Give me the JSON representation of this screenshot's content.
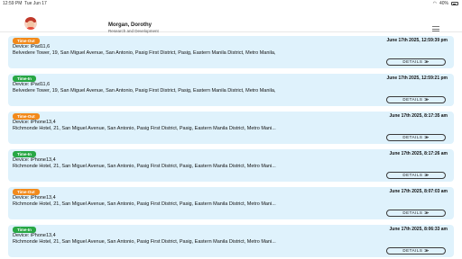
{
  "status_bar": {
    "time": "12:59 PM",
    "date": "Tue Jun 17",
    "battery": "40%"
  },
  "header": {
    "user_name": "Morgan, Dorothy",
    "department": "Research and Development"
  },
  "records": [
    {
      "badge": "Time-Out",
      "type": "out",
      "timestamp": "June 17th 2025, 12:59:39 pm",
      "device": "Device: iPad11,6",
      "address": "Belvedere Tower, 19, San Miguel Avenue, San Antonio, Pasig First District, Pasig, Eastern Manila District, Metro Manila,",
      "button": "DETAILS"
    },
    {
      "badge": "Time-In",
      "type": "in",
      "timestamp": "June 17th 2025, 12:59:21 pm",
      "device": "Device: iPad11,6",
      "address": "Belvedere Tower, 19, San Miguel Avenue, San Antonio, Pasig First District, Pasig, Eastern Manila District, Metro Manila,",
      "button": "DETAILS"
    },
    {
      "badge": "Time-Out",
      "type": "out",
      "timestamp": "June 17th 2025, 8:17:35 am",
      "device": "Device: iPhone13,4",
      "address": "Richmonde Hotel, 21, San Miguel Avenue, San Antonio, Pasig First District, Pasig, Eastern Manila District, Metro Mani...",
      "button": "DETAILS"
    },
    {
      "badge": "Time-In",
      "type": "in",
      "timestamp": "June 17th 2025, 8:17:26 am",
      "device": "Device: iPhone13,4",
      "address": "Richmonde Hotel, 21, San Miguel Avenue, San Antonio, Pasig First District, Pasig, Eastern Manila District, Metro Mani...",
      "button": "DETAILS"
    },
    {
      "badge": "Time-Out",
      "type": "out",
      "timestamp": "June 17th 2025, 8:07:03 am",
      "device": "Device: iPhone13,4",
      "address": "Richmonde Hotel, 21, San Miguel Avenue, San Antonio, Pasig First District, Pasig, Eastern Manila District, Metro Mani...",
      "button": "DETAILS"
    },
    {
      "badge": "Time-In",
      "type": "in",
      "timestamp": "June 17th 2025, 8:06:33 am",
      "device": "Device: iPhone13,4",
      "address": "Richmonde Hotel, 21, San Miguel Avenue, San Antonio, Pasig First District, Pasig, Eastern Manila District, Metro Mani...",
      "button": "DETAILS"
    }
  ]
}
